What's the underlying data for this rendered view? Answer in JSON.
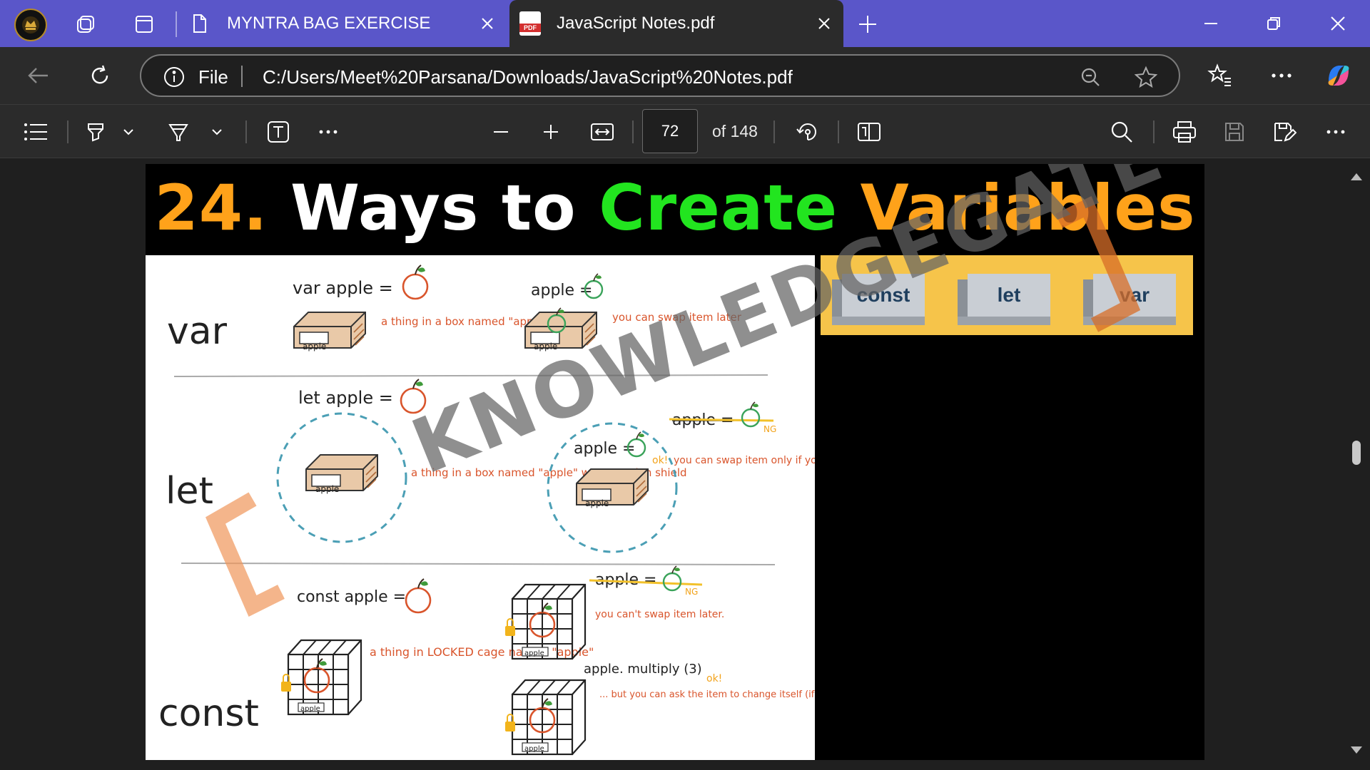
{
  "tabs": [
    {
      "title": "MYNTRA BAG EXERCISE",
      "active": false
    },
    {
      "title": "JavaScript Notes.pdf",
      "active": true
    }
  ],
  "address_bar": {
    "scheme_label": "File",
    "url": "C:/Users/Meet%20Parsana/Downloads/JavaScript%20Notes.pdf"
  },
  "pdf_toolbar": {
    "current_page": "72",
    "total_pages_label": "of 148"
  },
  "slide": {
    "title_number": "24.",
    "title_part1": "Ways to",
    "title_part2": "Create",
    "title_part3": "Variables",
    "keywords": [
      "const",
      "let",
      "var"
    ],
    "watermark": "KNOWLEDGEGATE"
  },
  "sketch": {
    "rows": [
      {
        "label": "var",
        "declaration": "var apple =",
        "box_label": "apple",
        "note1": "a thing in a box named \"apple\"",
        "reassign": "apple =",
        "note2": "you can swap item later"
      },
      {
        "label": "let",
        "declaration": "let apple =",
        "box_label": "apple",
        "note1": "a thing in a box named \"apple\" w/ protection shield",
        "reassign": "apple =",
        "reassign_crossed": "apple =",
        "ng": "NG",
        "ok": "ok!",
        "note2": "you can swap item only if you ask inside of the shield"
      },
      {
        "label": "const",
        "declaration": "const apple =",
        "box_label": "apple",
        "note1": "a thing in LOCKED cage named \"apple\"",
        "reassign_crossed": "apple =",
        "ng": "NG",
        "note2": "you can't swap item later.",
        "method_call": "apple. multiply (3)",
        "ok": "ok!",
        "note3": "... but you can ask the item to change itself (if the item has method to do that)"
      }
    ]
  },
  "colors": {
    "tabstrip": "#5a56c9",
    "chrome": "#2b2b2b",
    "title_orange": "#ffa21a",
    "title_green": "#22e51f",
    "keyword_panel": "#f6c44a",
    "sketch_red": "#d9552c",
    "sketch_teal": "#4b9fb5"
  },
  "icons": [
    "profile-avatar-icon",
    "workspaces-icon",
    "tab-actions-icon",
    "document-icon",
    "pdf-file-icon",
    "close-icon",
    "new-tab-icon",
    "minimize-icon",
    "restore-icon",
    "back-arrow-icon",
    "refresh-icon",
    "info-icon",
    "zoom-out-icon",
    "favorite-star-icon",
    "favorites-icon",
    "more-icon",
    "copilot-icon",
    "contents-list-icon",
    "highlight-icon",
    "draw-icon",
    "text-icon",
    "zoom-in-icon",
    "fit-width-icon",
    "rotate-icon",
    "page-view-icon",
    "search-icon",
    "print-icon",
    "save-icon",
    "save-as-icon"
  ]
}
